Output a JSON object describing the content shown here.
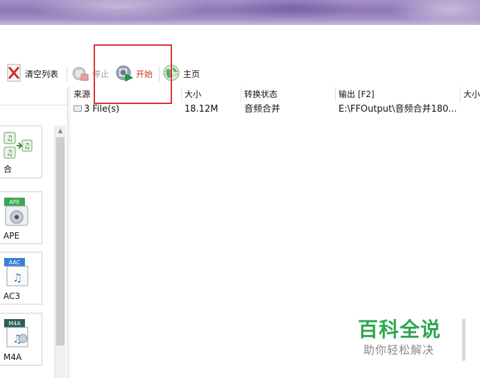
{
  "toolbar": {
    "clear_list_label": "清空列表",
    "stop_label": "停止",
    "start_label": "开始",
    "home_label": "主页"
  },
  "file_list": {
    "columns": [
      "来源",
      "大小",
      "转换状态",
      "输出 [F2]",
      "大小"
    ],
    "rows": [
      {
        "source": "3 File(s)",
        "size": "18.12M",
        "status": "音频合并",
        "output": "E:\\FFOutput\\音频合并180..."
      }
    ]
  },
  "left_panel": {
    "items": [
      {
        "label": "合",
        "icon": "audio-merge-icon"
      },
      {
        "label": "APE",
        "icon": "ape-format-icon"
      },
      {
        "label": "AC3",
        "icon": "aac-ac3-icon"
      },
      {
        "label": "M4A",
        "icon": "m4a-format-icon"
      }
    ],
    "badges": {
      "ape": "APE",
      "aac": "AAC",
      "m4a": "M4A"
    }
  },
  "watermark": {
    "title": "百科全说",
    "subtitle": "助你轻松解决"
  },
  "colors": {
    "highlight_box": "#d7332b",
    "start_label": "#c8381c",
    "watermark_green": "#2fa84f"
  }
}
